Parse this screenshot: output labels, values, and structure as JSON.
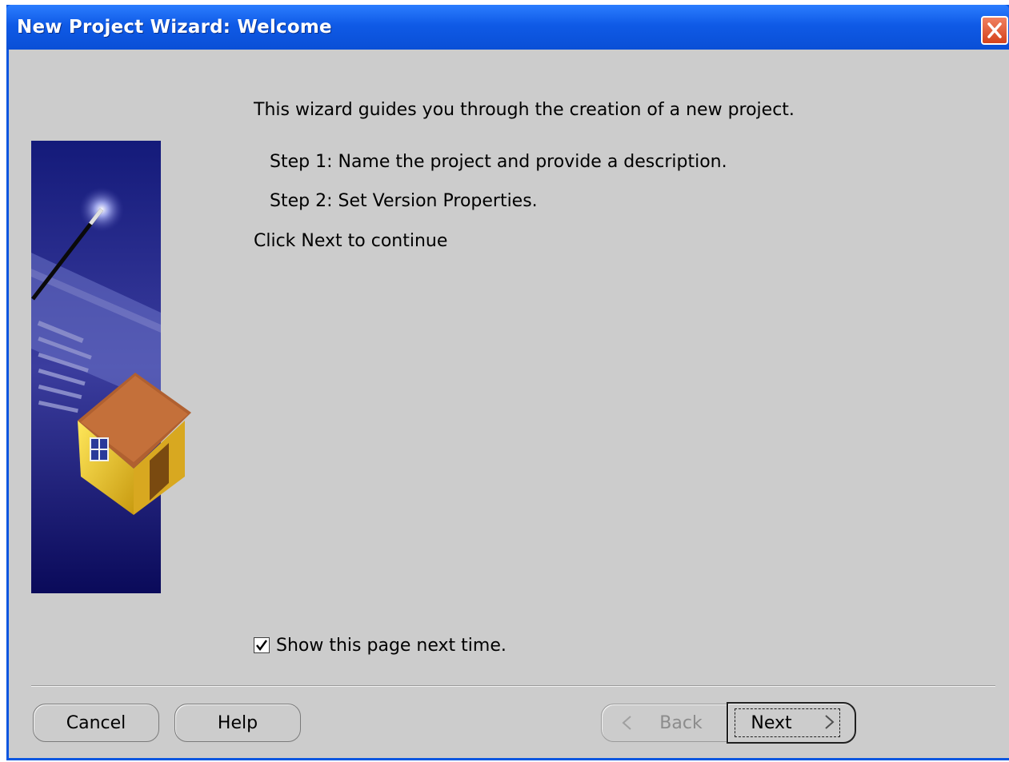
{
  "window": {
    "title": "New Project Wizard: Welcome"
  },
  "content": {
    "intro": "This wizard guides you through the creation of a new project.",
    "step1": "Step 1: Name the project and provide a description.",
    "step2": "Step 2: Set Version Properties.",
    "continue": "Click Next to continue"
  },
  "options": {
    "show_page_label": "Show this page next time.",
    "show_page_checked": true
  },
  "buttons": {
    "cancel": "Cancel",
    "help": "Help",
    "back": "Back",
    "next": "Next",
    "back_enabled": false
  },
  "icons": {
    "close": "close-icon",
    "wizard_image": "wizard-house-illustration",
    "back_arrow": "chevron-left-icon",
    "next_arrow": "chevron-right-icon"
  },
  "colors": {
    "titlebar": "#0a56e0",
    "client_bg": "#cccccc",
    "close_button": "#d4421c"
  }
}
